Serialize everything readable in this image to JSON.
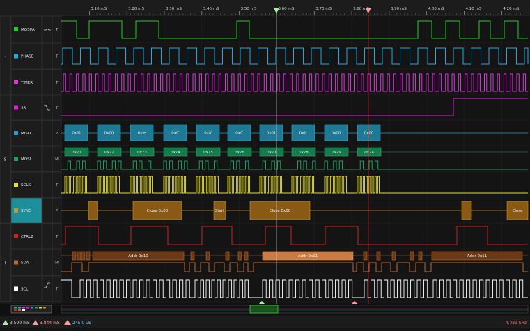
{
  "ruler": {
    "ticks": [
      {
        "t": 3.1,
        "label": "3.10 mS"
      },
      {
        "t": 3.2,
        "label": "3.20 mS"
      },
      {
        "t": 3.3,
        "label": "3.30 mS"
      },
      {
        "t": 3.4,
        "label": "3.40 mS"
      },
      {
        "t": 3.5,
        "label": "3.50 mS"
      },
      {
        "t": 3.6,
        "label": "3.60 mS"
      },
      {
        "t": 3.7,
        "label": "3.70 mS"
      },
      {
        "t": 3.8,
        "label": "3.80 mS"
      },
      {
        "t": 3.9,
        "label": "3.90 mS"
      },
      {
        "t": 4.0,
        "label": "4.00 mS"
      },
      {
        "t": 4.1,
        "label": "4.10 mS"
      },
      {
        "t": 4.2,
        "label": "4.20 mS"
      }
    ],
    "range_ms": [
      3.025,
      4.27
    ]
  },
  "cursors": {
    "a_ms": 3.599,
    "b_ms": 3.844,
    "a_color": "#a8f0a8",
    "b_color": "#ff9a9a"
  },
  "groups": [
    {
      "id": "g1",
      "label": ".",
      "rows": [
        0,
        2
      ]
    },
    {
      "id": "g2",
      "label": "S",
      "rows": [
        3,
        7
      ]
    },
    {
      "id": "g3",
      "label": "I",
      "rows": [
        8,
        10
      ]
    }
  ],
  "channels": [
    {
      "name": "MOSI/A",
      "color": "#22cc22",
      "mode": "T"
    },
    {
      "name": "PHASE",
      "color": "#22aadd",
      "mode": "T"
    },
    {
      "name": "TIMER",
      "color": "#dd33dd",
      "mode": "T"
    },
    {
      "name": "SS",
      "color": "#dd22dd",
      "mode": "T"
    },
    {
      "name": "MISO",
      "color": "#2a9acb",
      "mode": "P"
    },
    {
      "name": "MOSI",
      "color": "#1fa060",
      "mode": "M"
    },
    {
      "name": "SCLK",
      "color": "#e6e022",
      "mode": "T"
    },
    {
      "name": "SYNC",
      "color": "#c8962a",
      "mode": "P",
      "selected": true
    },
    {
      "name": "CTRL2",
      "color": "#cc2222",
      "mode": "T"
    },
    {
      "name": "SDA",
      "color": "#b86a36",
      "mode": "M"
    },
    {
      "name": "SCL",
      "color": "#ffffff",
      "mode": "T"
    }
  ],
  "miso_bytes": [
    "0xf0",
    "0x00",
    "0xfe",
    "0xff",
    "0xff",
    "0xff",
    "0x01",
    "0xfc",
    "0x00",
    "0x00"
  ],
  "mosi_bytes": [
    "0x71",
    "0x72",
    "0x73",
    "0x74",
    "0x75",
    "0x76",
    "0x77",
    "0x78",
    "0x79",
    "0x7a"
  ],
  "sync_events": [
    "Close 0x00",
    "Start",
    "Close 0x00",
    "Close"
  ],
  "sda_events": [
    "Addr 0x10",
    "Addr 0x11",
    "Addr 0x11"
  ],
  "status": {
    "cursor_a": "3.599 mS",
    "cursor_b": "3.844 mS",
    "delta": "245.0 uS",
    "freq": "4.081 kHz"
  }
}
